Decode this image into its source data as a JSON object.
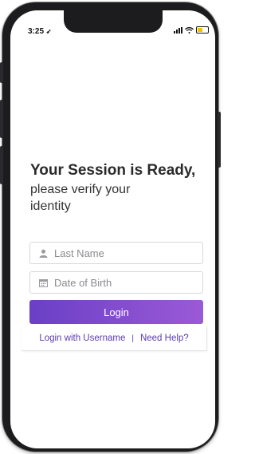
{
  "status_bar": {
    "time": "3:25",
    "location_glyph": "➶"
  },
  "heading": {
    "title": "Your Session is Ready,",
    "subtitle_line1": "please verify your",
    "subtitle_line2": "identity"
  },
  "form": {
    "last_name_placeholder": "Last Name",
    "dob_placeholder": "Date of Birth",
    "login_label": "Login"
  },
  "links": {
    "login_username": "Login with Username",
    "separator": "|",
    "need_help": "Need Help?"
  },
  "colors": {
    "accent_start": "#6a3fc6",
    "accent_end": "#9b5ad6",
    "link": "#5b3bb0"
  }
}
